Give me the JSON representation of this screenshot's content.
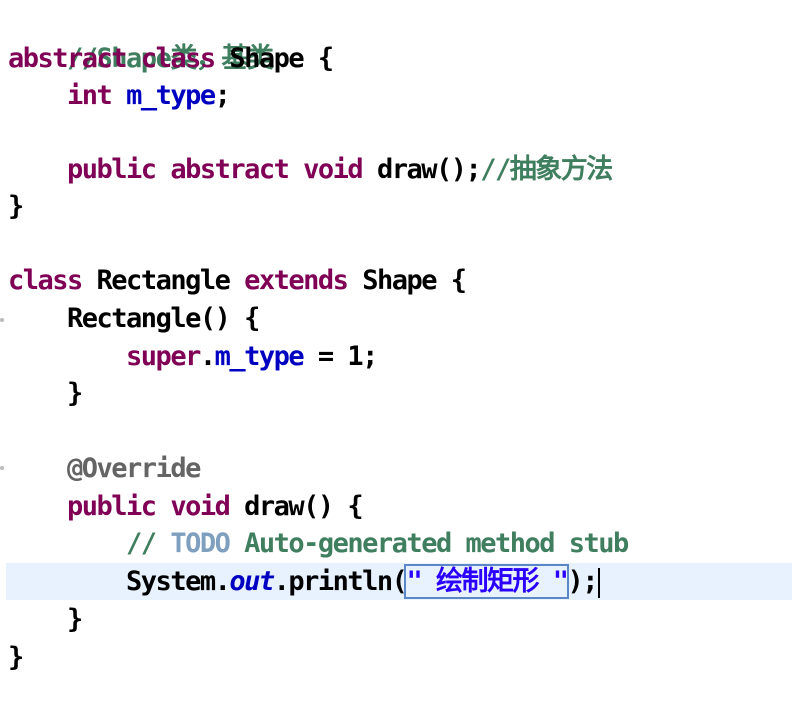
{
  "lines": {
    "l1": {
      "comment": "//Shape类，基类"
    },
    "l2": {
      "kw1": "abstract",
      "kw2": "class",
      "name": "Shape",
      "brace": "{"
    },
    "l3": {
      "type": "int",
      "field": "m_type",
      "semi": ";"
    },
    "l4": {
      "kw1": "public",
      "kw2": "abstract",
      "kw3": "void",
      "method": "draw();",
      "comment": "//抽象方法"
    },
    "l5": {
      "brace": "}"
    },
    "l6": {
      "kw1": "class",
      "name": "Rectangle",
      "kw2": "extends",
      "parent": "Shape",
      "brace": "{"
    },
    "l7": {
      "ctor": "Rectangle() {"
    },
    "l8": {
      "kw": "super",
      "dot": ".",
      "field": "m_type",
      "rest": " = 1;"
    },
    "l9": {
      "brace": "}"
    },
    "l10": {
      "annotation": "@Override"
    },
    "l11": {
      "kw1": "public",
      "kw2": "void",
      "method": "draw() {"
    },
    "l12": {
      "slashes": "//",
      "todo": "TODO",
      "text": "Auto-generated method stub"
    },
    "l13": {
      "obj": "System.",
      "static_field": "out",
      "call": ".println(",
      "string": "\" 绘制矩形 \"",
      "end": ");"
    },
    "l14": {
      "brace": "}"
    },
    "l15": {
      "brace": "}"
    }
  }
}
